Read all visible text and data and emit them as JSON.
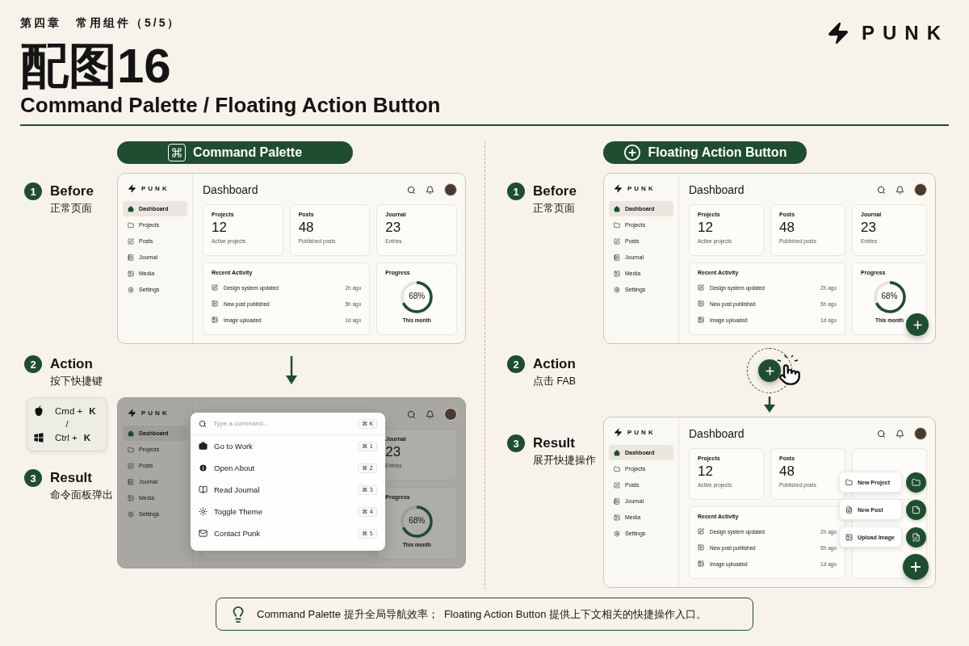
{
  "header": {
    "chapter": "第四章",
    "section": "常用组件（5/5）",
    "title": "配图16",
    "subtitle": "Command Palette / Floating Action Button",
    "brand": "PUNK"
  },
  "panels": [
    {
      "kind": "command_palette",
      "banner": "Command Palette",
      "steps": [
        {
          "number": "1",
          "title": "Before",
          "caption": "正常页面"
        },
        {
          "number": "2",
          "title": "Action",
          "caption": "按下快捷键"
        },
        {
          "number": "3",
          "title": "Result",
          "caption": "命令面板弹出"
        }
      ],
      "shortcuts": {
        "rows": [
          {
            "kind": "mac",
            "modifier": "Cmd +",
            "key": "K"
          },
          {
            "kind": "windows",
            "modifier": "Ctrl +",
            "key": "K"
          }
        ],
        "separator": "/"
      },
      "before": {
        "brand": "PUNK",
        "title": "Dashboard",
        "nav": [
          {
            "label": "Dashboard",
            "selected": true
          },
          {
            "label": "Projects",
            "selected": false
          },
          {
            "label": "Posts",
            "selected": false
          },
          {
            "label": "Journal",
            "selected": false
          },
          {
            "label": "Media",
            "selected": false
          },
          {
            "label": "Settings",
            "selected": false
          }
        ],
        "stats": [
          {
            "label": "Projects",
            "value": "12",
            "caption": "Active projects"
          },
          {
            "label": "Posts",
            "value": "48",
            "caption": "Published posts"
          },
          {
            "label": "Journal",
            "value": "23",
            "caption": "Entries"
          }
        ],
        "activity": {
          "title": "Recent Activity",
          "items": [
            {
              "text": "Design system updated",
              "time": "2h ago"
            },
            {
              "text": "New post published",
              "time": "5h ago"
            },
            {
              "text": "Image uploaded",
              "time": "1d ago"
            }
          ]
        },
        "progress": {
          "title": "Progress",
          "level": 0.68,
          "reading": "68%",
          "caption": "This month"
        }
      },
      "result": {
        "brand": "PUNK",
        "nav": [
          {
            "label": "Dashboard",
            "selected": true
          },
          {
            "label": "Projects",
            "selected": false
          },
          {
            "label": "Posts",
            "selected": false
          },
          {
            "label": "Journal",
            "selected": false
          },
          {
            "label": "Media",
            "selected": false
          },
          {
            "label": "Settings",
            "selected": false
          }
        ],
        "stats": [
          {
            "label": "Journal",
            "value": "23",
            "caption": "Entries"
          }
        ],
        "progress": {
          "title": "Progress",
          "level": 0.68,
          "reading": "68%",
          "caption": "This month"
        },
        "palette": {
          "placeholder": "Type a command...",
          "shortcut": "⌘ K",
          "items": [
            {
              "label": "Go to Work",
              "shortcut": "⌘ 1"
            },
            {
              "label": "Open About",
              "shortcut": "⌘ 2"
            },
            {
              "label": "Read Journal",
              "shortcut": "⌘ 3"
            },
            {
              "label": "Toggle Theme",
              "shortcut": "⌘ 4"
            },
            {
              "label": "Contact Punk",
              "shortcut": "⌘ 5"
            }
          ]
        }
      }
    },
    {
      "kind": "fab",
      "banner": "Floating Action Button",
      "steps": [
        {
          "number": "1",
          "title": "Before",
          "caption": "正常页面"
        },
        {
          "number": "2",
          "title": "Action",
          "caption": "点击 FAB"
        },
        {
          "number": "3",
          "title": "Result",
          "caption": "展开快捷操作"
        }
      ],
      "before": {
        "brand": "PUNK",
        "title": "Dashboard",
        "nav": [
          {
            "label": "Dashboard",
            "selected": true
          },
          {
            "label": "Projects",
            "selected": false
          },
          {
            "label": "Posts",
            "selected": false
          },
          {
            "label": "Journal",
            "selected": false
          },
          {
            "label": "Media",
            "selected": false
          },
          {
            "label": "Settings",
            "selected": false
          }
        ],
        "stats": [
          {
            "label": "Projects",
            "value": "12",
            "caption": "Active projects"
          },
          {
            "label": "Posts",
            "value": "48",
            "caption": "Published posts"
          },
          {
            "label": "Journal",
            "value": "23",
            "caption": "Entries"
          }
        ],
        "activity": {
          "title": "Recent Activity",
          "items": [
            {
              "text": "Design system updated",
              "time": "2h ago"
            },
            {
              "text": "New post published",
              "time": "5h ago"
            },
            {
              "text": "Image uploaded",
              "time": "1d ago"
            }
          ]
        },
        "progress": {
          "title": "Progress",
          "level": 0.68,
          "reading": "68%",
          "caption": "This month"
        },
        "fab": {
          "expanded": false
        }
      },
      "result": {
        "brand": "PUNK",
        "title": "Dashboard",
        "nav": [
          {
            "label": "Dashboard",
            "selected": true
          },
          {
            "label": "Projects",
            "selected": false
          },
          {
            "label": "Posts",
            "selected": false
          },
          {
            "label": "Journal",
            "selected": false
          },
          {
            "label": "Media",
            "selected": false
          },
          {
            "label": "Settings",
            "selected": false
          }
        ],
        "stats": [
          {
            "label": "Projects",
            "value": "12",
            "caption": "Active projects"
          },
          {
            "label": "Posts",
            "value": "48",
            "caption": "Published posts"
          }
        ],
        "activity": {
          "title": "Recent Activity",
          "items": [
            {
              "text": "Design system updated",
              "time": "2h ago"
            },
            {
              "text": "New post published",
              "time": "5h ago"
            },
            {
              "text": "Image uploaded",
              "time": "1d ago"
            }
          ]
        },
        "fab": {
          "expanded": true,
          "actions": [
            {
              "label": "New Project"
            },
            {
              "label": "New Post"
            },
            {
              "label": "Upload Image"
            }
          ]
        }
      }
    }
  ],
  "tip": "Command Palette 提升全局导航效率；  Floating Action Button 提供上下文相关的快捷操作入口。"
}
